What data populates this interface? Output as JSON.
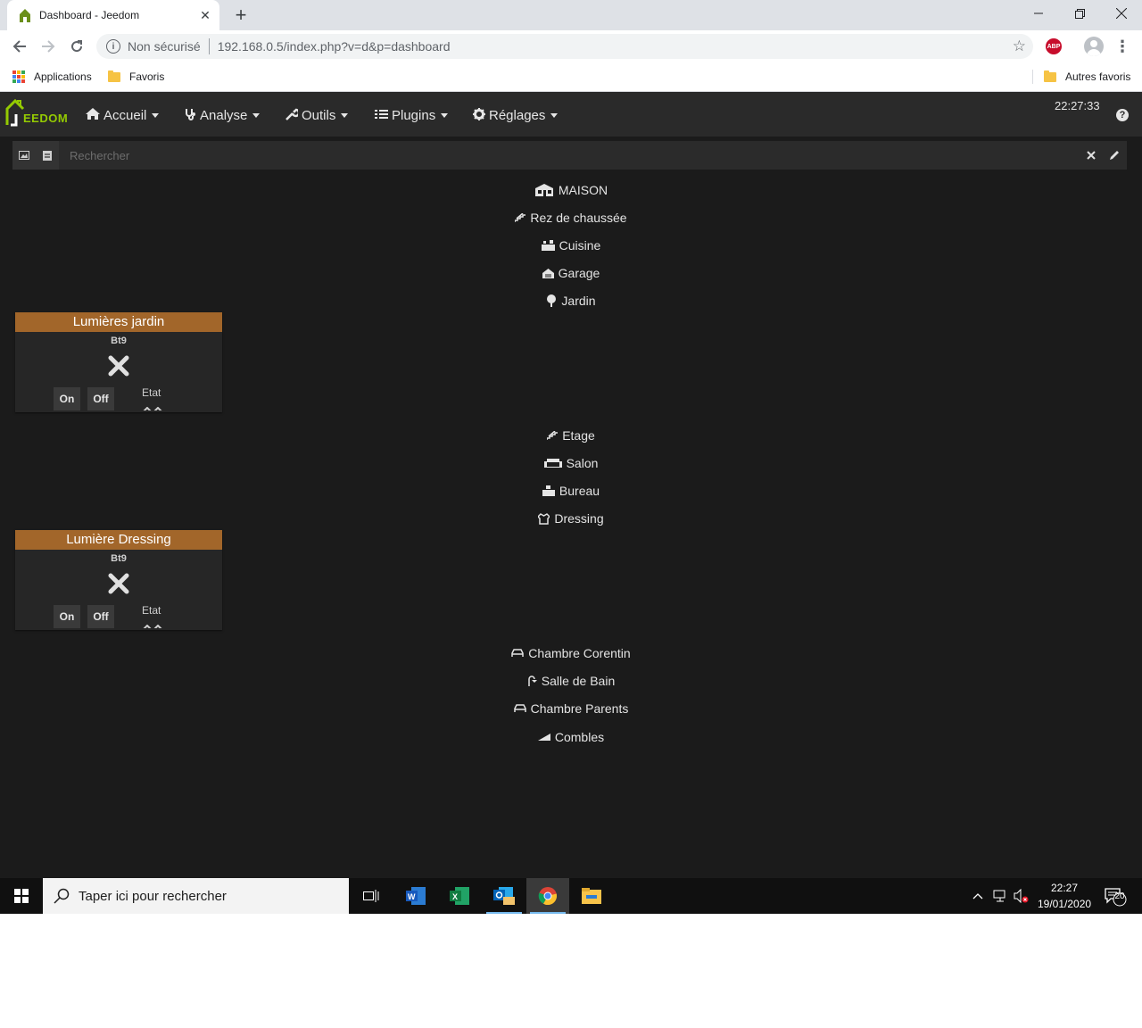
{
  "browser": {
    "tab_title": "Dashboard - Jeedom",
    "security_label": "Non sécurisé",
    "url": "192.168.0.5/index.php?v=d&p=dashboard",
    "bookmarks": {
      "apps_label": "Applications",
      "favoris_label": "Favoris",
      "autres_label": "Autres favoris"
    },
    "extension_badge": "ABP"
  },
  "app": {
    "logo_text": "EEDOM",
    "menu": [
      {
        "label": "Accueil",
        "icon": "home-icon"
      },
      {
        "label": "Analyse",
        "icon": "stethoscope-icon"
      },
      {
        "label": "Outils",
        "icon": "wrench-icon"
      },
      {
        "label": "Plugins",
        "icon": "tasks-icon"
      },
      {
        "label": "Réglages",
        "icon": "gear-icon"
      }
    ],
    "clock": "22:27:33",
    "search": {
      "placeholder": "Rechercher"
    },
    "rooms": [
      {
        "label": "MAISON",
        "icon": "house-icon"
      },
      {
        "label": "Rez de chaussée",
        "icon": "stairs-icon"
      },
      {
        "label": "Cuisine",
        "icon": "kitchen-icon"
      },
      {
        "label": "Garage",
        "icon": "garage-icon"
      },
      {
        "label": "Jardin",
        "icon": "tree-icon"
      },
      {
        "label": "Etage",
        "icon": "stairs-icon"
      },
      {
        "label": "Salon",
        "icon": "sofa-icon"
      },
      {
        "label": "Bureau",
        "icon": "desk-icon"
      },
      {
        "label": "Dressing",
        "icon": "hanger-icon"
      },
      {
        "label": "Chambre Corentin",
        "icon": "bed-icon"
      },
      {
        "label": "Salle de Bain",
        "icon": "shower-icon"
      },
      {
        "label": "Chambre Parents",
        "icon": "bed-icon"
      },
      {
        "label": "Combles",
        "icon": "attic-icon"
      }
    ],
    "widgets": [
      {
        "title": "Lumières jardin",
        "cmd_name": "Bt9",
        "on_label": "On",
        "off_label": "Off",
        "etat_label": "Etat"
      },
      {
        "title": "Lumière Dressing",
        "cmd_name": "Bt9",
        "on_label": "On",
        "off_label": "Off",
        "etat_label": "Etat"
      }
    ],
    "colors": {
      "background": "#1b1b1b",
      "navbar": "#2a2a2a",
      "widget_header": "#a2662a",
      "logo_green": "#94ca02"
    }
  },
  "taskbar": {
    "search_placeholder": "Taper ici pour rechercher",
    "time": "22:27",
    "date": "19/01/2020",
    "notifications": "20"
  }
}
